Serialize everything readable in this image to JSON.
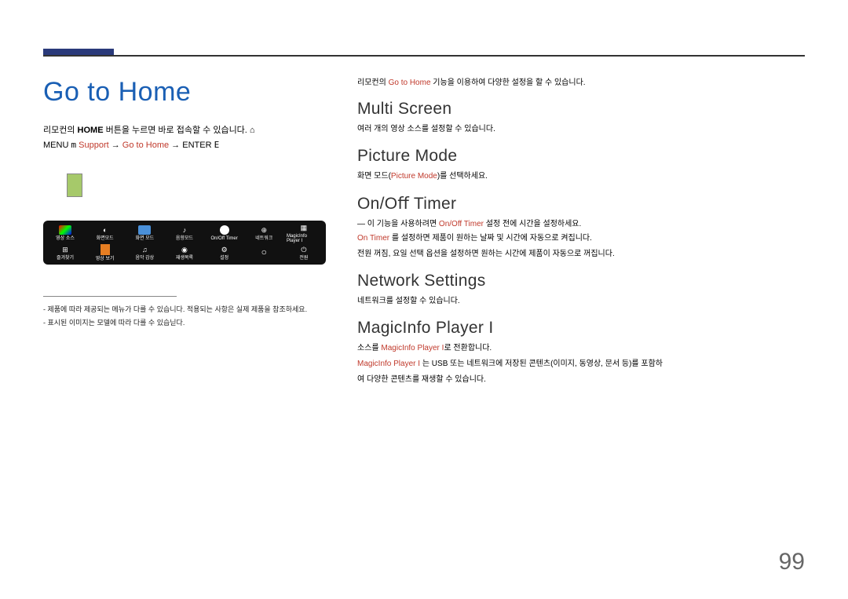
{
  "header": {
    "title": "Go to Home",
    "home_note_prefix": "리모컨의 ",
    "home_note_key": "HOME",
    "home_note_suffix": " 버튼을 누르면 바로 접속할 수 있습니다.",
    "menu_prefix": "MENU ",
    "menu_m": "m",
    "menu_sep": " → ",
    "menu_support": "Support",
    "menu_goto": "Go to Home",
    "menu_enter": "ENTER ",
    "menu_e": "E",
    "home_glyph": "⌂"
  },
  "dock": {
    "row1": [
      {
        "icon": "ci-color",
        "label": "영상 소스"
      },
      {
        "icon": "",
        "label": "화면모드",
        "glyph": "◐"
      },
      {
        "icon": "ci-blue",
        "label": "화면 모드"
      },
      {
        "icon": "",
        "label": "음향모드",
        "glyph": "♪"
      },
      {
        "icon": "ci-white",
        "label": "On/Off Timer"
      },
      {
        "icon": "",
        "label": "네트워크",
        "glyph": "⊕"
      },
      {
        "icon": "",
        "label": "MagicInfo Player I",
        "glyph": "▦"
      }
    ],
    "row2": [
      {
        "icon": "ci-grid",
        "label": "즐겨찾기",
        "glyph": "⊞"
      },
      {
        "icon": "ci-orange",
        "label": "영상 보기"
      },
      {
        "icon": "",
        "label": "음악 감상",
        "glyph": "♫"
      },
      {
        "icon": "",
        "label": "재생목록",
        "glyph": "◉"
      },
      {
        "icon": "",
        "label": "설정",
        "glyph": "⚙"
      },
      {
        "icon": "ci-dot",
        "label": "",
        "glyph": "○"
      },
      {
        "icon": "",
        "label": "전원",
        "glyph": "⏻"
      }
    ]
  },
  "footnotes": {
    "f1": "- 제품에 따라 제공되는 메뉴가 다를 수 있습니다. 적용되는 사항은 실제 제품을 참조하세요.",
    "f2": "- 표시된 이미지는 모델에 따라 다를 수 있습닏다."
  },
  "right": {
    "intro_prefix": "리모컨의 ",
    "intro_accent": "Go to Home",
    "intro_suffix": " 기능을 이용하여 다양한 설정을 할 수 있습니다.",
    "multi_screen": {
      "title": "Multi Screen",
      "desc": "여러 개의 영상 소스를 설정할 수 있습니다."
    },
    "picture_mode": {
      "title": "Picture  Mode",
      "desc_prefix": "화면 모드(",
      "desc_accent": "Picture Mode",
      "desc_suffix": ")를 선택하세요."
    },
    "onoff_timer": {
      "title": "On/Oﬀ  Timer",
      "dash_prefix": "이 기능을 사용하려면 ",
      "dash_accent1": "On/Off Timer",
      "dash_suffix": " 설정 전에 시간을 설정하세요.",
      "line2_prefix": "",
      "line2_accent": "On Timer",
      "line2_suffix": " 를 설정하면 제품이 원하는 날짜 및 시간에 자동으로 켜집니다.",
      "line3": "전원 꺼짐, 요일 선택 옵션을 설정하면 원하는 시간에 제품이 자동으로 꺼집니다."
    },
    "network": {
      "title": "Network  Settings",
      "desc": "네트워크를 설정할 수 있습니다."
    },
    "magicinfo": {
      "title": "MagicInfo Player I",
      "line1_prefix": "소스를 ",
      "line1_accent": "MagicInfo Player I",
      "line1_suffix": "로 전환합니다.",
      "line2_accent": "MagicInfo Player I",
      "line2_suffix": " 는 USB 또는 네트워크에 저장된 콘텐츠(이미지, 동영상, 문서 등)를 포함하",
      "line3": "여 다양한 콘텐츠를 재생할 수 있습니다."
    }
  },
  "page_number": "99"
}
